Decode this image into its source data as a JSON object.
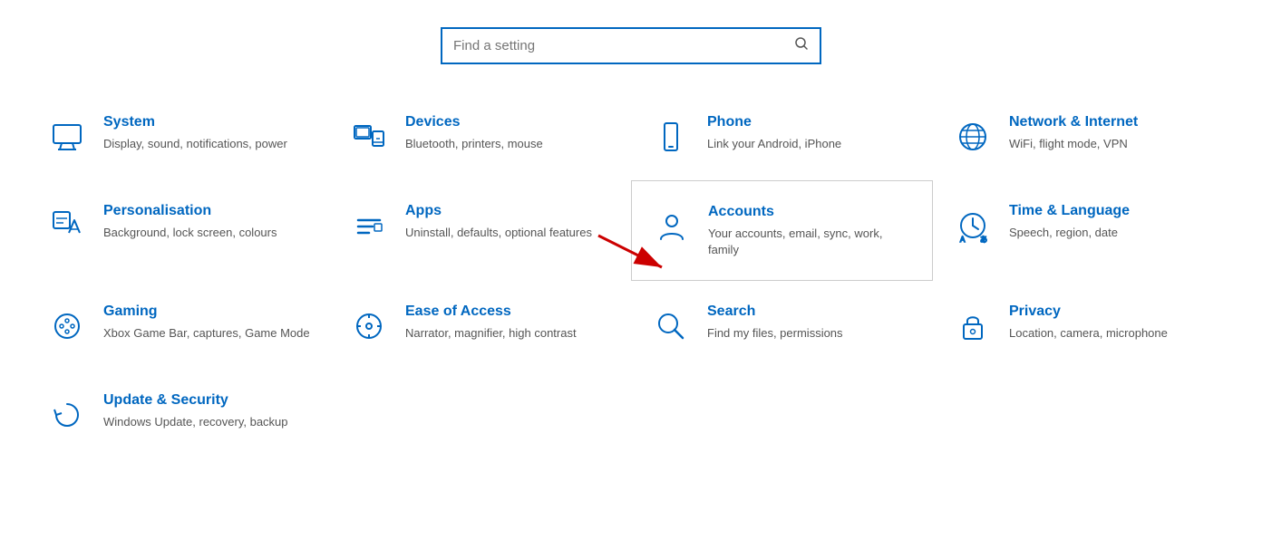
{
  "search": {
    "placeholder": "Find a setting"
  },
  "items": [
    {
      "id": "system",
      "title": "System",
      "desc": "Display, sound, notifications, power",
      "icon": "system"
    },
    {
      "id": "devices",
      "title": "Devices",
      "desc": "Bluetooth, printers, mouse",
      "icon": "devices"
    },
    {
      "id": "phone",
      "title": "Phone",
      "desc": "Link your Android, iPhone",
      "icon": "phone"
    },
    {
      "id": "network",
      "title": "Network & Internet",
      "desc": "WiFi, flight mode, VPN",
      "icon": "network"
    },
    {
      "id": "personalisation",
      "title": "Personalisation",
      "desc": "Background, lock screen, colours",
      "icon": "personalisation"
    },
    {
      "id": "apps",
      "title": "Apps",
      "desc": "Uninstall, defaults, optional features",
      "icon": "apps"
    },
    {
      "id": "accounts",
      "title": "Accounts",
      "desc": "Your accounts, email, sync, work, family",
      "icon": "accounts",
      "highlighted": true
    },
    {
      "id": "time",
      "title": "Time & Language",
      "desc": "Speech, region, date",
      "icon": "time"
    },
    {
      "id": "gaming",
      "title": "Gaming",
      "desc": "Xbox Game Bar, captures, Game Mode",
      "icon": "gaming"
    },
    {
      "id": "ease",
      "title": "Ease of Access",
      "desc": "Narrator, magnifier, high contrast",
      "icon": "ease"
    },
    {
      "id": "search",
      "title": "Search",
      "desc": "Find my files, permissions",
      "icon": "search"
    },
    {
      "id": "privacy",
      "title": "Privacy",
      "desc": "Location, camera, microphone",
      "icon": "privacy"
    },
    {
      "id": "update",
      "title": "Update & Security",
      "desc": "Windows Update, recovery, backup",
      "icon": "update"
    }
  ]
}
